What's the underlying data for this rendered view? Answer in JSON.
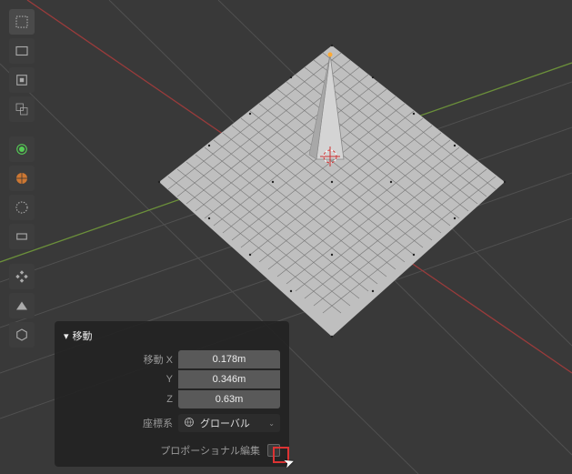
{
  "panel": {
    "title": "移動",
    "rows": {
      "move_x_label": "移動 X",
      "move_x_value": "0.178m",
      "move_y_label": "Y",
      "move_y_value": "0.346m",
      "move_z_label": "Z",
      "move_z_value": "0.63m",
      "orientation_label": "座標系",
      "orientation_value": "グローバル",
      "proportional_label": "プロポーショナル編集"
    }
  },
  "toolbar": {
    "items": [
      "cursor",
      "select-box",
      "select-circle",
      "move",
      "rotate",
      "scale",
      "transform",
      "annotate",
      "measure",
      "add-cube",
      "extrude",
      "shrink"
    ]
  }
}
